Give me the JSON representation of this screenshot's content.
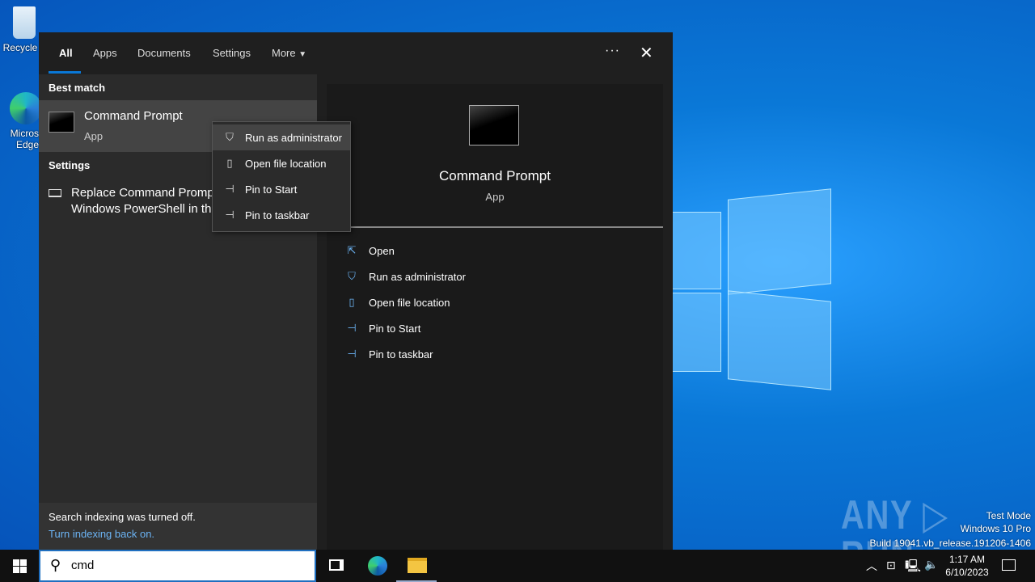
{
  "desktop": {
    "icons": [
      {
        "label": "Recycle"
      },
      {
        "label": "Micros\nEdge"
      }
    ]
  },
  "tabs": [
    {
      "label": "All"
    },
    {
      "label": "Apps"
    },
    {
      "label": "Documents"
    },
    {
      "label": "Settings"
    },
    {
      "label": "More"
    }
  ],
  "more_icon": "ellipsis-icon",
  "close_icon": "close-icon",
  "left": {
    "best_match_header": "Best match",
    "best": {
      "title": "Command Prompt",
      "subtitle": "App"
    },
    "settings_header": "Settings",
    "setting_item": "Replace Command Prompt with Windows PowerShell in the",
    "setting_line1": "Replace Command Prompt",
    "setting_line2": "Windows PowerShell in the",
    "indexing_text": "Search indexing was turned off.",
    "indexing_link": "Turn indexing back on."
  },
  "context_menu": [
    {
      "label": "Run as administrator",
      "icon": "shield-icon"
    },
    {
      "label": "Open file location",
      "icon": "folder-icon"
    },
    {
      "label": "Pin to Start",
      "icon": "pin-icon"
    },
    {
      "label": "Pin to taskbar",
      "icon": "pin-icon"
    }
  ],
  "right": {
    "title": "Command Prompt",
    "subtitle": "App",
    "actions": [
      {
        "label": "Open"
      },
      {
        "label": "Run as administrator"
      },
      {
        "label": "Open file location"
      },
      {
        "label": "Pin to Start"
      },
      {
        "label": "Pin to taskbar"
      }
    ]
  },
  "taskbar": {
    "search_value": "cmd",
    "time": "1:17 AM",
    "date": "6/10/2023"
  },
  "watermark": {
    "logo": "ANY RUN",
    "line1": "Test Mode",
    "line2": "Windows 10 Pro",
    "line3": "Build 19041.vb_release.191206-1406"
  }
}
